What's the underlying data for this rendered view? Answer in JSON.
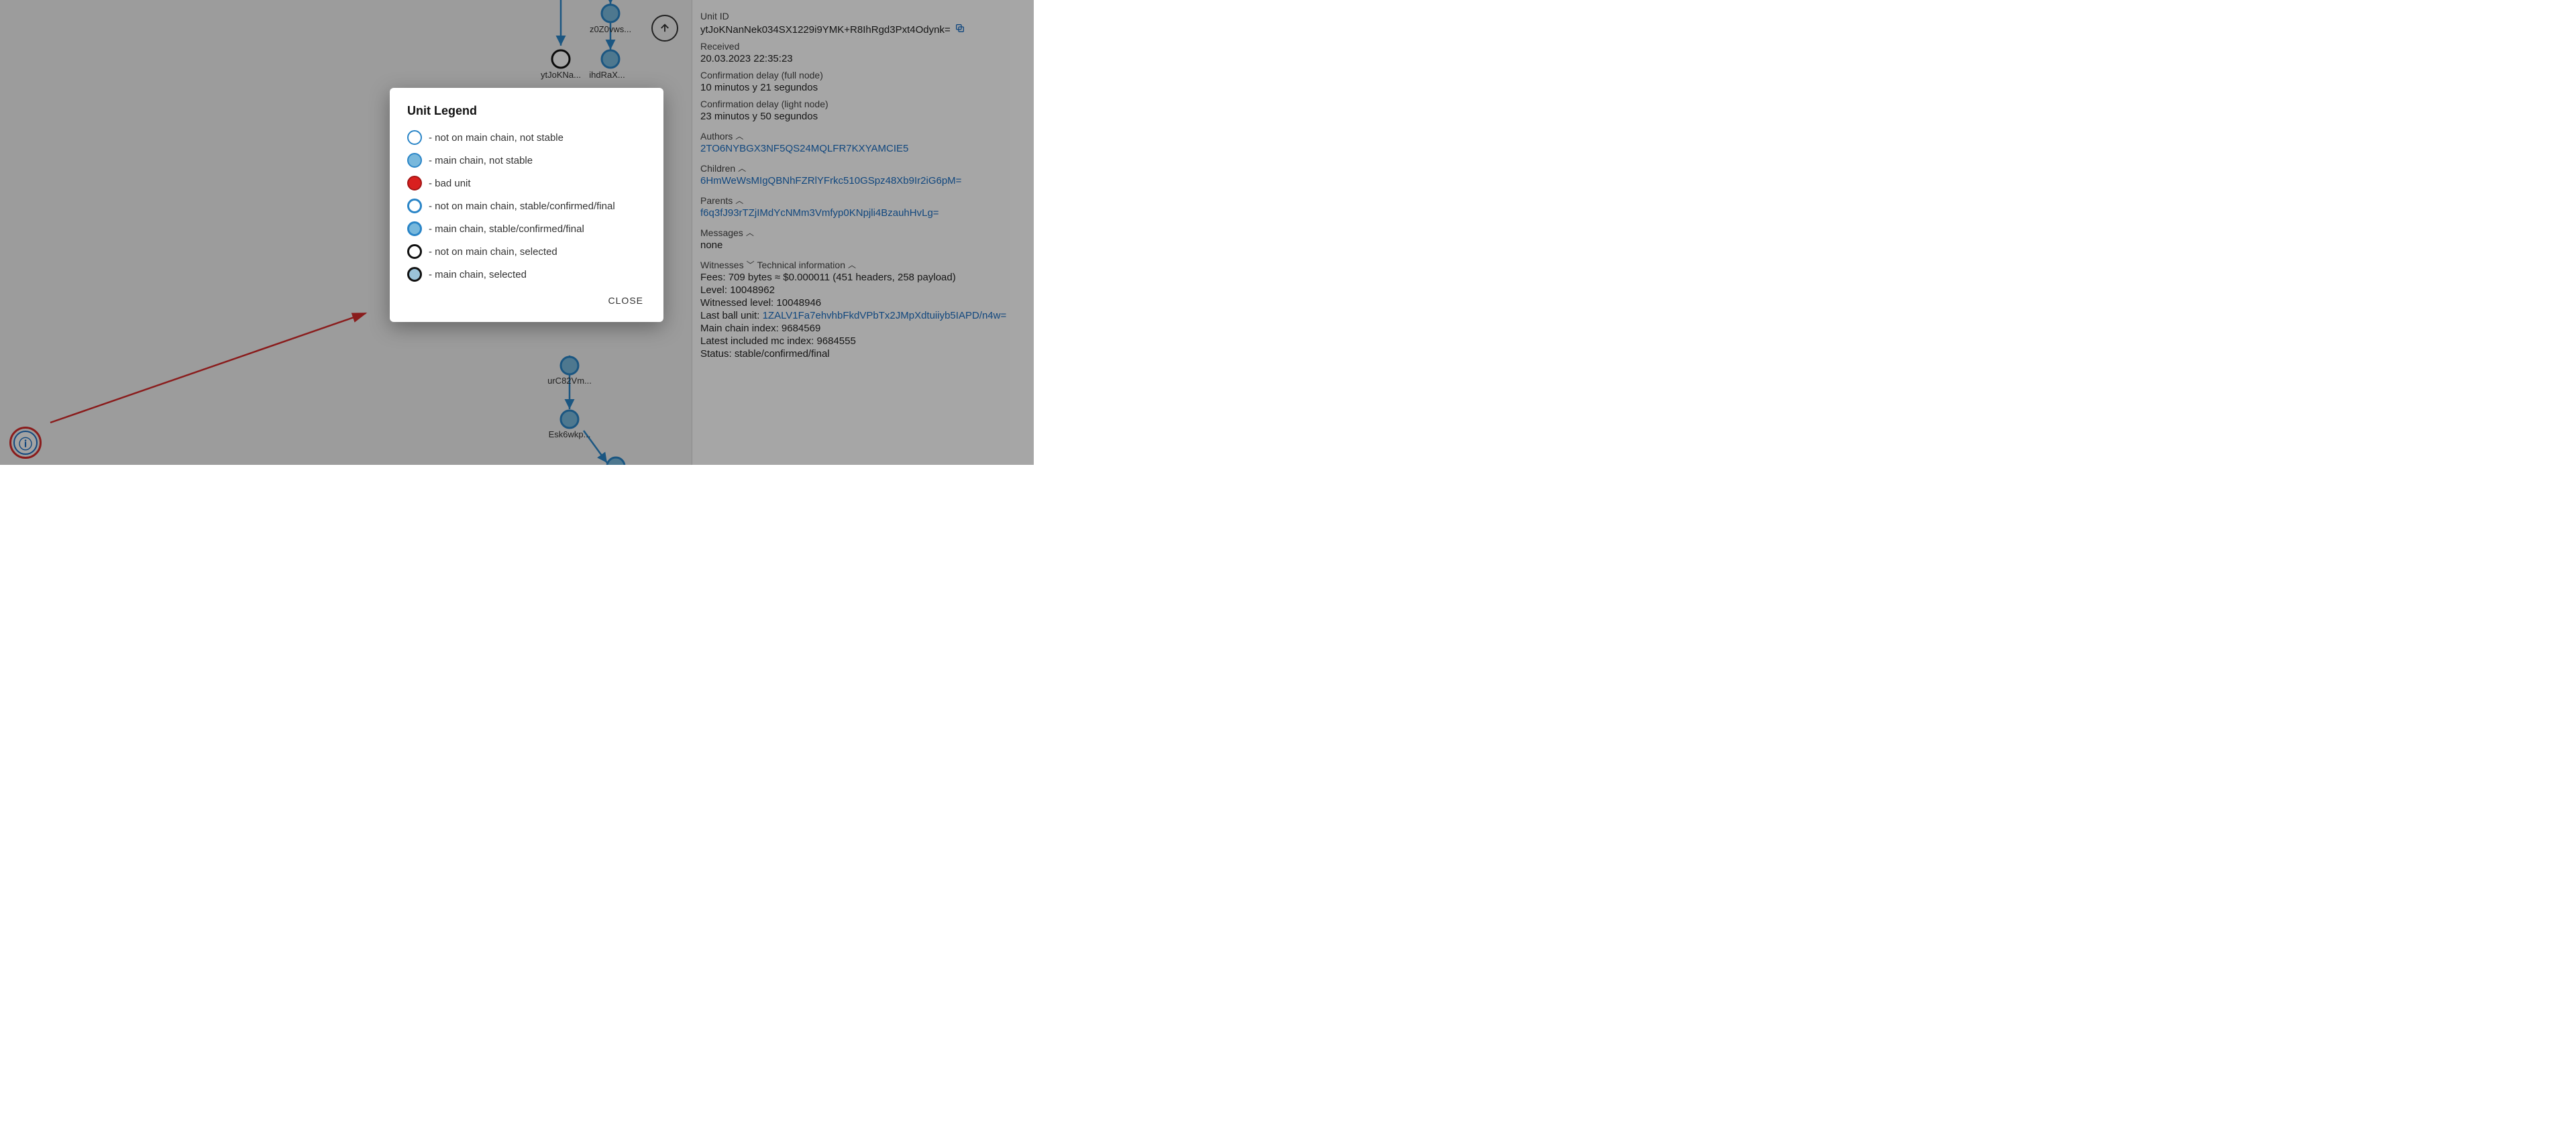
{
  "modal": {
    "title": "Unit Legend",
    "close_label": "CLOSE",
    "items": [
      "- not on main chain, not stable",
      "- main chain, not stable",
      "- bad unit",
      "- not on main chain, stable/confirmed/final",
      "- main chain, stable/confirmed/final",
      "- not on main chain, selected",
      "- main chain, selected"
    ]
  },
  "graph": {
    "nodes": {
      "z0Z0": "z0Z0vws...",
      "ytJoK": "ytJoKNa...",
      "ihdRaX": "ihdRaX...",
      "urC8": "urC82Vm...",
      "Esk6": "Esk6wkp..."
    }
  },
  "panel": {
    "unit_id_label": "Unit ID",
    "unit_id_value": "ytJoKNanNek034SX1229i9YMK+R8IhRgd3Pxt4Odynk=",
    "received_label": "Received",
    "received_value": "20.03.2023 22:35:23",
    "conf_full_label": "Confirmation delay (full node)",
    "conf_full_value": "10 minutos y 21 segundos",
    "conf_light_label": "Confirmation delay (light node)",
    "conf_light_value": "23 minutos y 50 segundos",
    "authors_label": "Authors",
    "author_link": "2TO6NYBGX3NF5QS24MQLFR7KXYAMCIE5",
    "children_label": "Children",
    "child_link": "6HmWeWsMIgQBNhFZRlYFrkc510GSpz48Xb9Ir2iG6pM=",
    "parents_label": "Parents",
    "parent_link": "f6q3fJ93rTZjIMdYcNMm3Vmfyp0KNpjli4BzauhHvLg=",
    "messages_label": "Messages",
    "messages_value": "none",
    "witnesses_label": "Witnesses",
    "tech_label": "Technical information",
    "fees_label": "Fees:",
    "fees_value": "709 bytes ≈ $0.000011 (451 headers, 258 payload)",
    "level_label": "Level:",
    "level_value": "10048962",
    "witlevel_label": "Witnessed level:",
    "witlevel_value": "10048946",
    "lastball_label": "Last ball unit:",
    "lastball_link": "1ZALV1Fa7ehvhbFkdVPbTx2JMpXdtuiiyb5IAPD/n4w=",
    "mci_label": "Main chain index:",
    "mci_value": "9684569",
    "lmci_label": "Latest included mc index:",
    "lmci_value": "9684555",
    "status_label": "Status:",
    "status_value": "stable/confirmed/final"
  }
}
